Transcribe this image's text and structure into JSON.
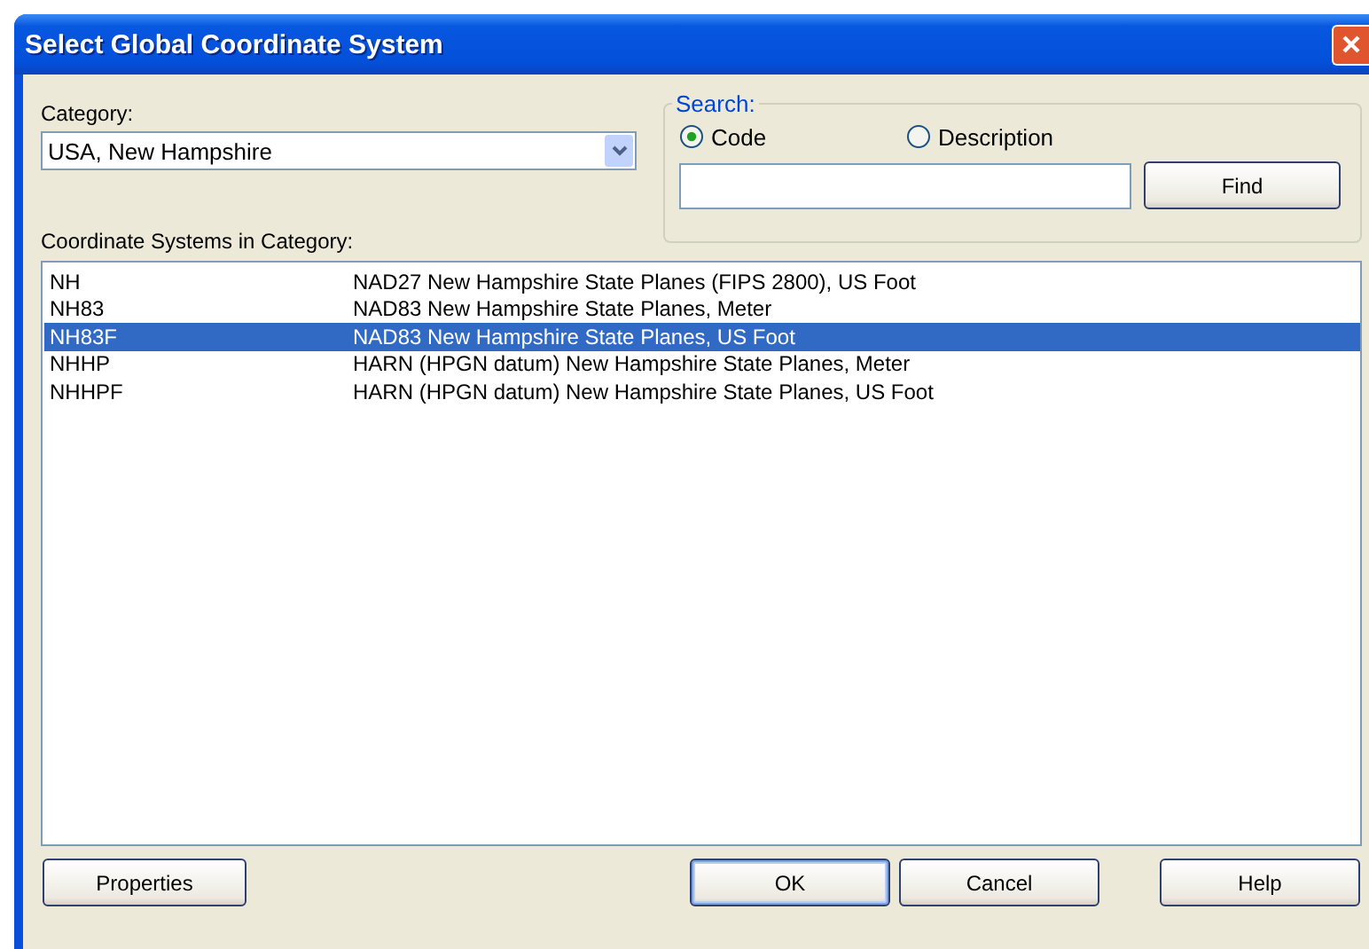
{
  "window": {
    "title": "Select Global Coordinate System"
  },
  "category": {
    "label": "Category:",
    "value": "USA, New Hampshire"
  },
  "search": {
    "label": "Search:",
    "options": [
      {
        "label": "Code",
        "selected": true
      },
      {
        "label": "Description",
        "selected": false
      }
    ],
    "button": "Find"
  },
  "list": {
    "label": "Coordinate Systems in Category:",
    "rows": [
      {
        "code": "NH",
        "description": "NAD27 New Hampshire State Planes (FIPS 2800), US Foot",
        "selected": false
      },
      {
        "code": "NH83",
        "description": "NAD83 New Hampshire State Planes, Meter",
        "selected": false
      },
      {
        "code": "NH83F",
        "description": "NAD83 New Hampshire State Planes, US Foot",
        "selected": true
      },
      {
        "code": "NHHP",
        "description": "HARN (HPGN datum) New Hampshire State Planes, Meter",
        "selected": false
      },
      {
        "code": "NHHPF",
        "description": "HARN (HPGN datum) New Hampshire State Planes, US Foot",
        "selected": false
      }
    ]
  },
  "buttons": [
    "Properties",
    "OK",
    "Cancel",
    "Help"
  ]
}
